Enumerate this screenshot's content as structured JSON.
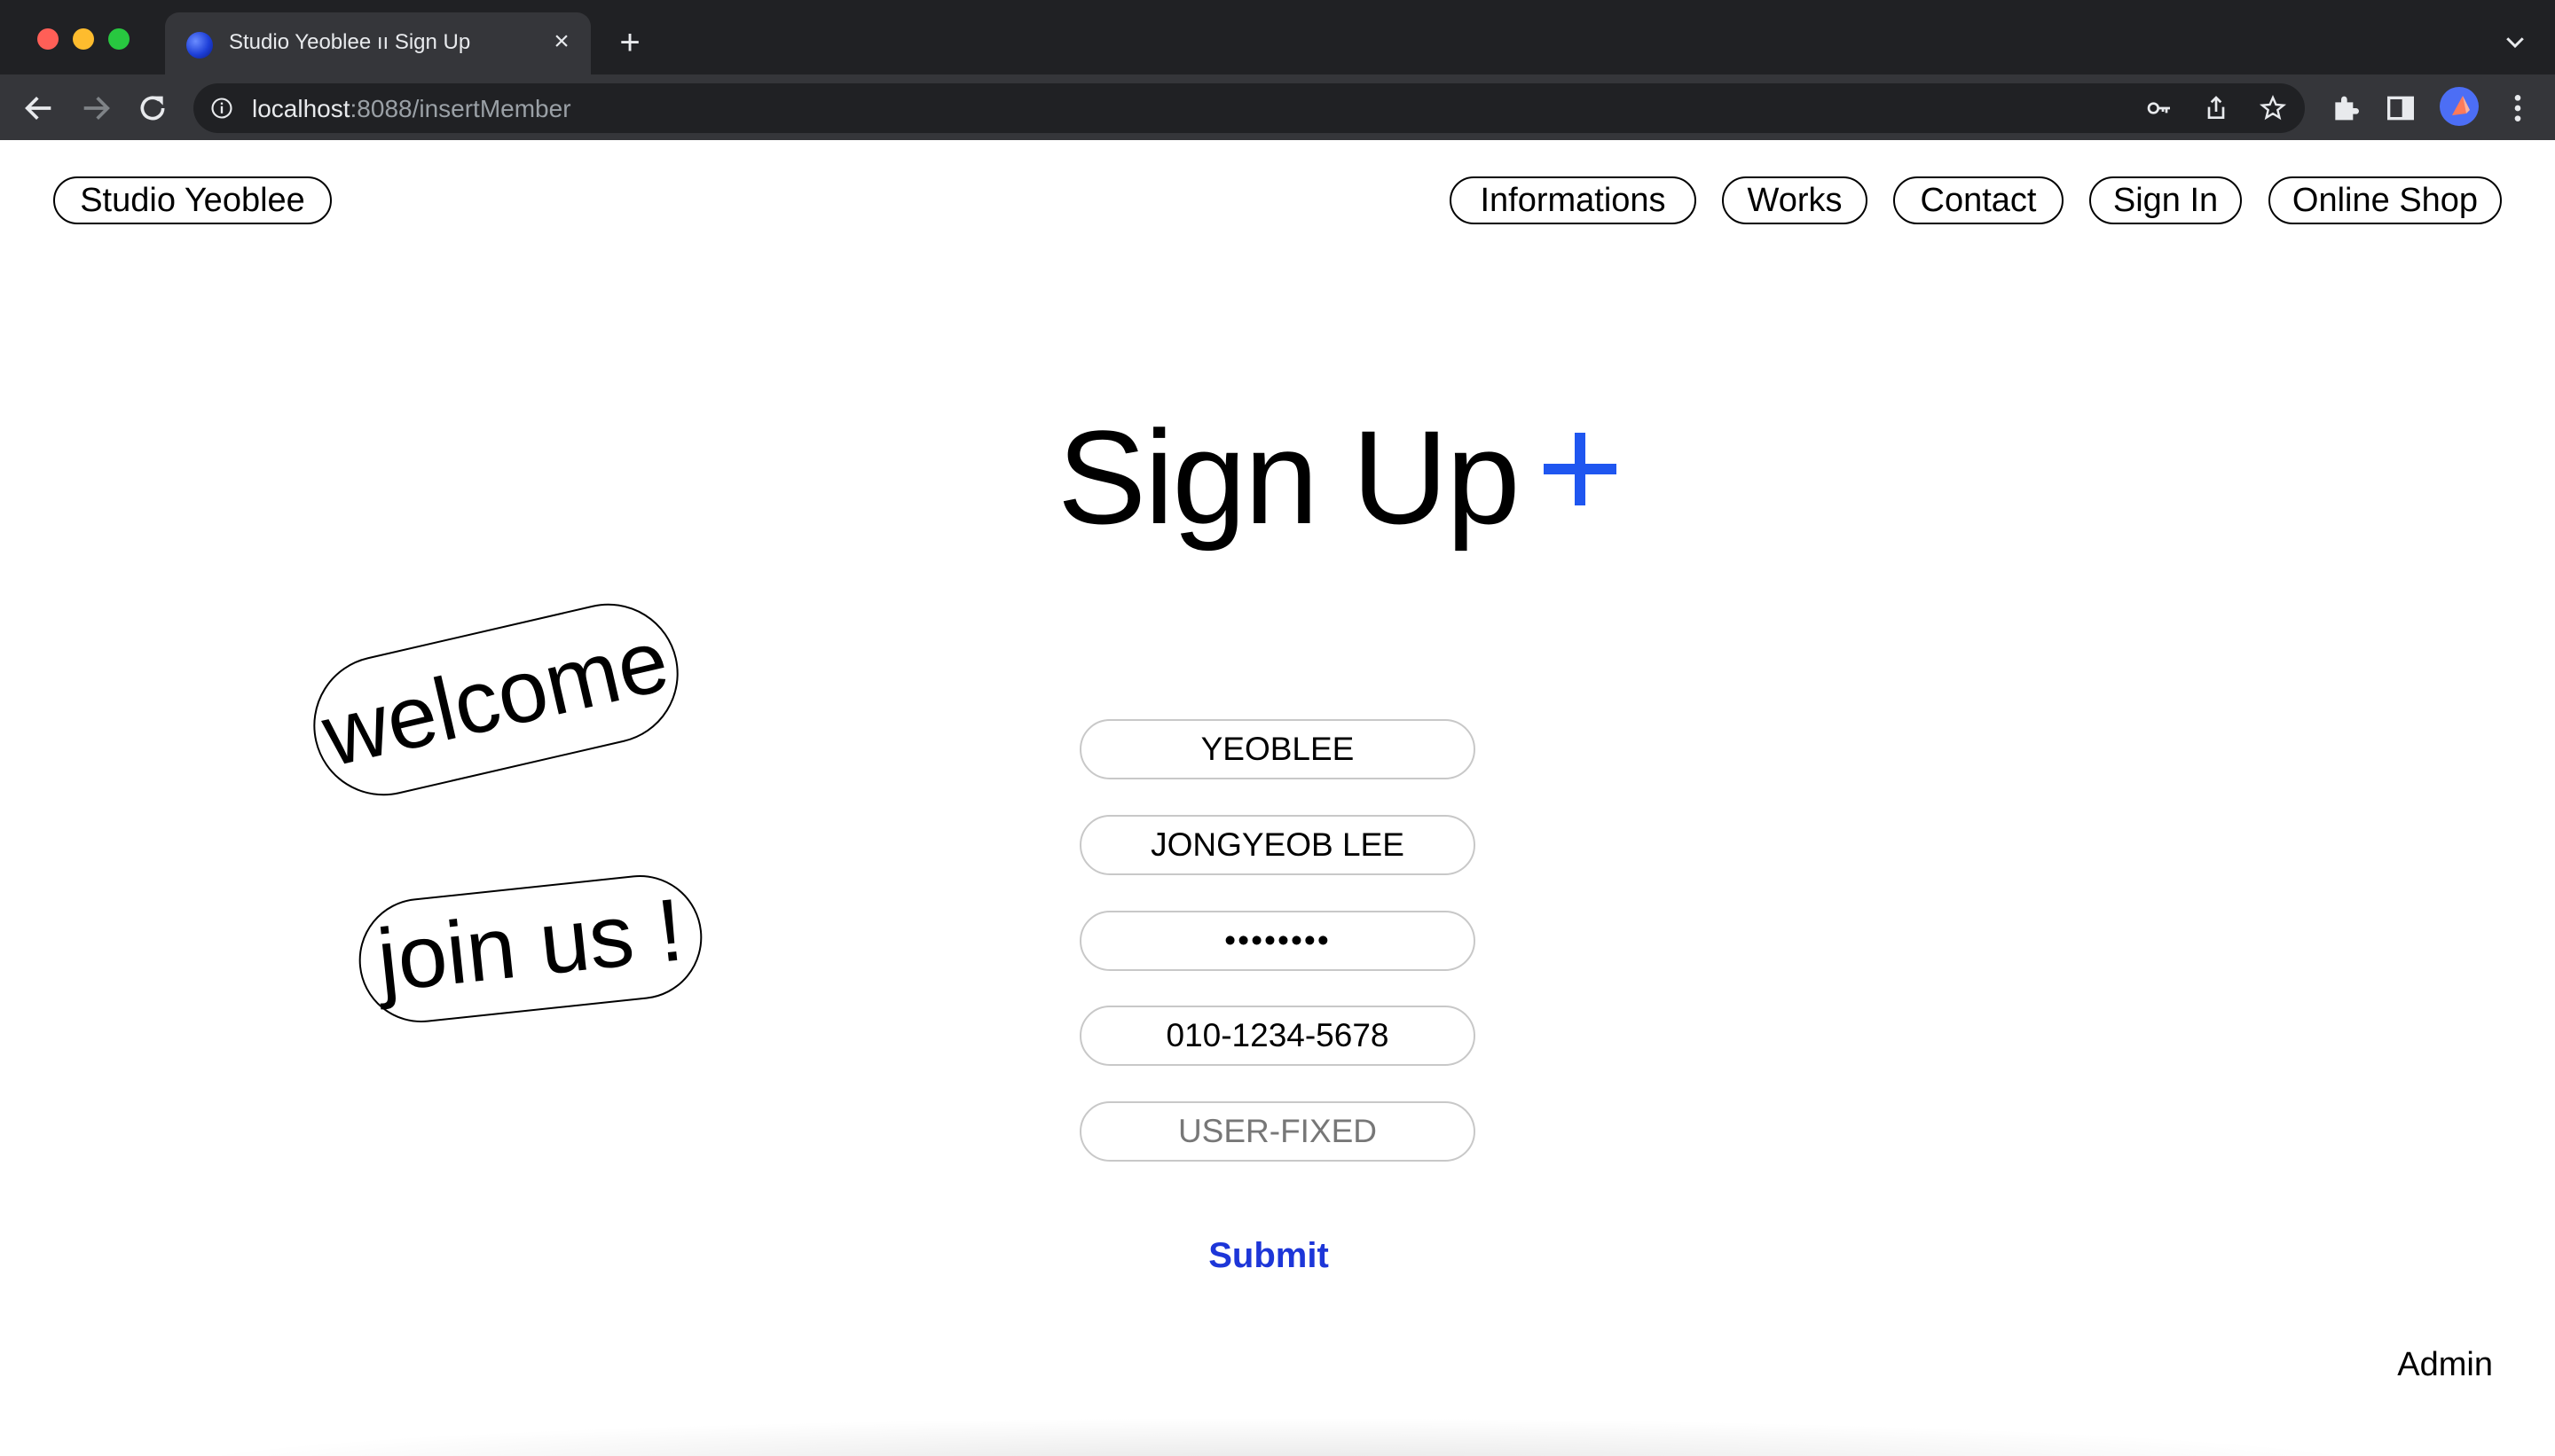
{
  "browser": {
    "tab_title": "Studio Yeoblee ıı Sign Up",
    "url_host": "localhost",
    "url_path": ":8088/insertMember"
  },
  "site": {
    "logo": "Studio Yeoblee",
    "nav": {
      "informations": "Informations",
      "works": "Works",
      "contact": "Contact",
      "sign_in": "Sign In",
      "online_shop": "Online Shop"
    }
  },
  "main": {
    "title": "Sign Up",
    "plus_color": "#1f56f0",
    "stickers": {
      "welcome": "welcome",
      "join": "join us !"
    },
    "form": {
      "user_id": "YEOBLEE",
      "name": "JONGYEOB LEE",
      "password": "••••••••",
      "phone": "010-1234-5678",
      "role": "USER-FIXED"
    },
    "submit_label": "Submit",
    "submit_color": "#1d36d8",
    "admin_link": "Admin"
  }
}
